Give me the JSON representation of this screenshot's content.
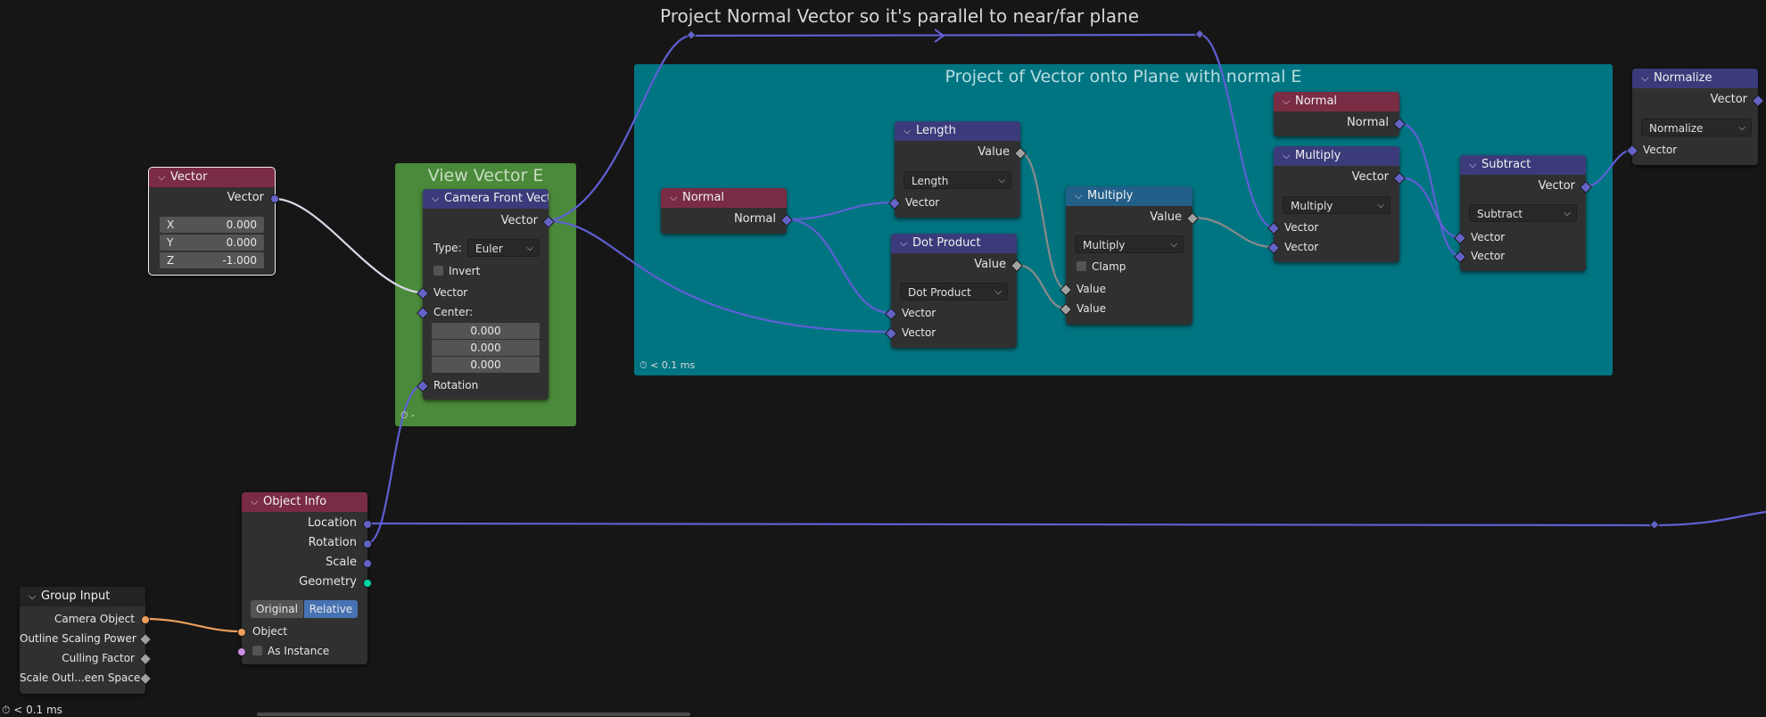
{
  "canvas": {
    "title": "Project Normal Vector so it's parallel to near/far plane",
    "status_timing": "< 0.1 ms"
  },
  "colors": {
    "canvas_bg": "#161616",
    "frame_green": "#4b8a3a",
    "frame_teal": "#007582",
    "header_input": "#7a2c44",
    "header_vector": "#3b3b7b",
    "header_math": "#22608a",
    "socket_vector": "#6363c7",
    "socket_float": "#a1a1a1",
    "socket_object": "#ed9e5c",
    "socket_geometry": "#00d6a3",
    "button_active": "#4772b3"
  },
  "frames": {
    "view": {
      "label": "View Vector E",
      "timing": "-"
    },
    "project": {
      "label": "Project of Vector onto Plane with normal E",
      "timing": "< 0.1 ms"
    }
  },
  "nodes": {
    "vector": {
      "title": "Vector",
      "output": "Vector",
      "fields": [
        {
          "label": "X",
          "value": "0.000"
        },
        {
          "label": "Y",
          "value": "0.000"
        },
        {
          "label": "Z",
          "value": "-1.000"
        }
      ]
    },
    "camera_front": {
      "title": "Camera Front Vector",
      "output": "Vector",
      "type_label": "Type:",
      "type_value": "Euler",
      "invert_label": "Invert",
      "input_vector": "Vector",
      "center_label": "Center:",
      "center_values": [
        "0.000",
        "0.000",
        "0.000"
      ],
      "rotation_label": "Rotation"
    },
    "object_info": {
      "title": "Object Info",
      "outputs": [
        "Location",
        "Rotation",
        "Scale",
        "Geometry"
      ],
      "mode_options": [
        "Original",
        "Relative"
      ],
      "mode_selected": "Relative",
      "object_label": "Object",
      "as_instance_label": "As Instance"
    },
    "group_input": {
      "title": "Group Input",
      "outputs": [
        "Camera Object",
        "Outline Scaling Power",
        "Culling Factor",
        "Scale Outl...een Space"
      ]
    },
    "normal_a": {
      "title": "Normal",
      "output": "Normal"
    },
    "length": {
      "title": "Length",
      "output": "Value",
      "mode": "Length",
      "input": "Vector"
    },
    "dot": {
      "title": "Dot Product",
      "output": "Value",
      "mode": "Dot Product",
      "inputs": [
        "Vector",
        "Vector"
      ]
    },
    "multiply_f": {
      "title": "Multiply",
      "output": "Value",
      "mode": "Multiply",
      "clamp_label": "Clamp",
      "inputs": [
        "Value",
        "Value"
      ]
    },
    "normal_b": {
      "title": "Normal",
      "output": "Normal"
    },
    "multiply_v": {
      "title": "Multiply",
      "output": "Vector",
      "mode": "Multiply",
      "inputs": [
        "Vector",
        "Vector"
      ]
    },
    "subtract": {
      "title": "Subtract",
      "output": "Vector",
      "mode": "Subtract",
      "inputs": [
        "Vector",
        "Vector"
      ]
    },
    "normalize": {
      "title": "Normalize",
      "output": "Vector",
      "mode": "Normalize",
      "input": "Vector"
    }
  }
}
